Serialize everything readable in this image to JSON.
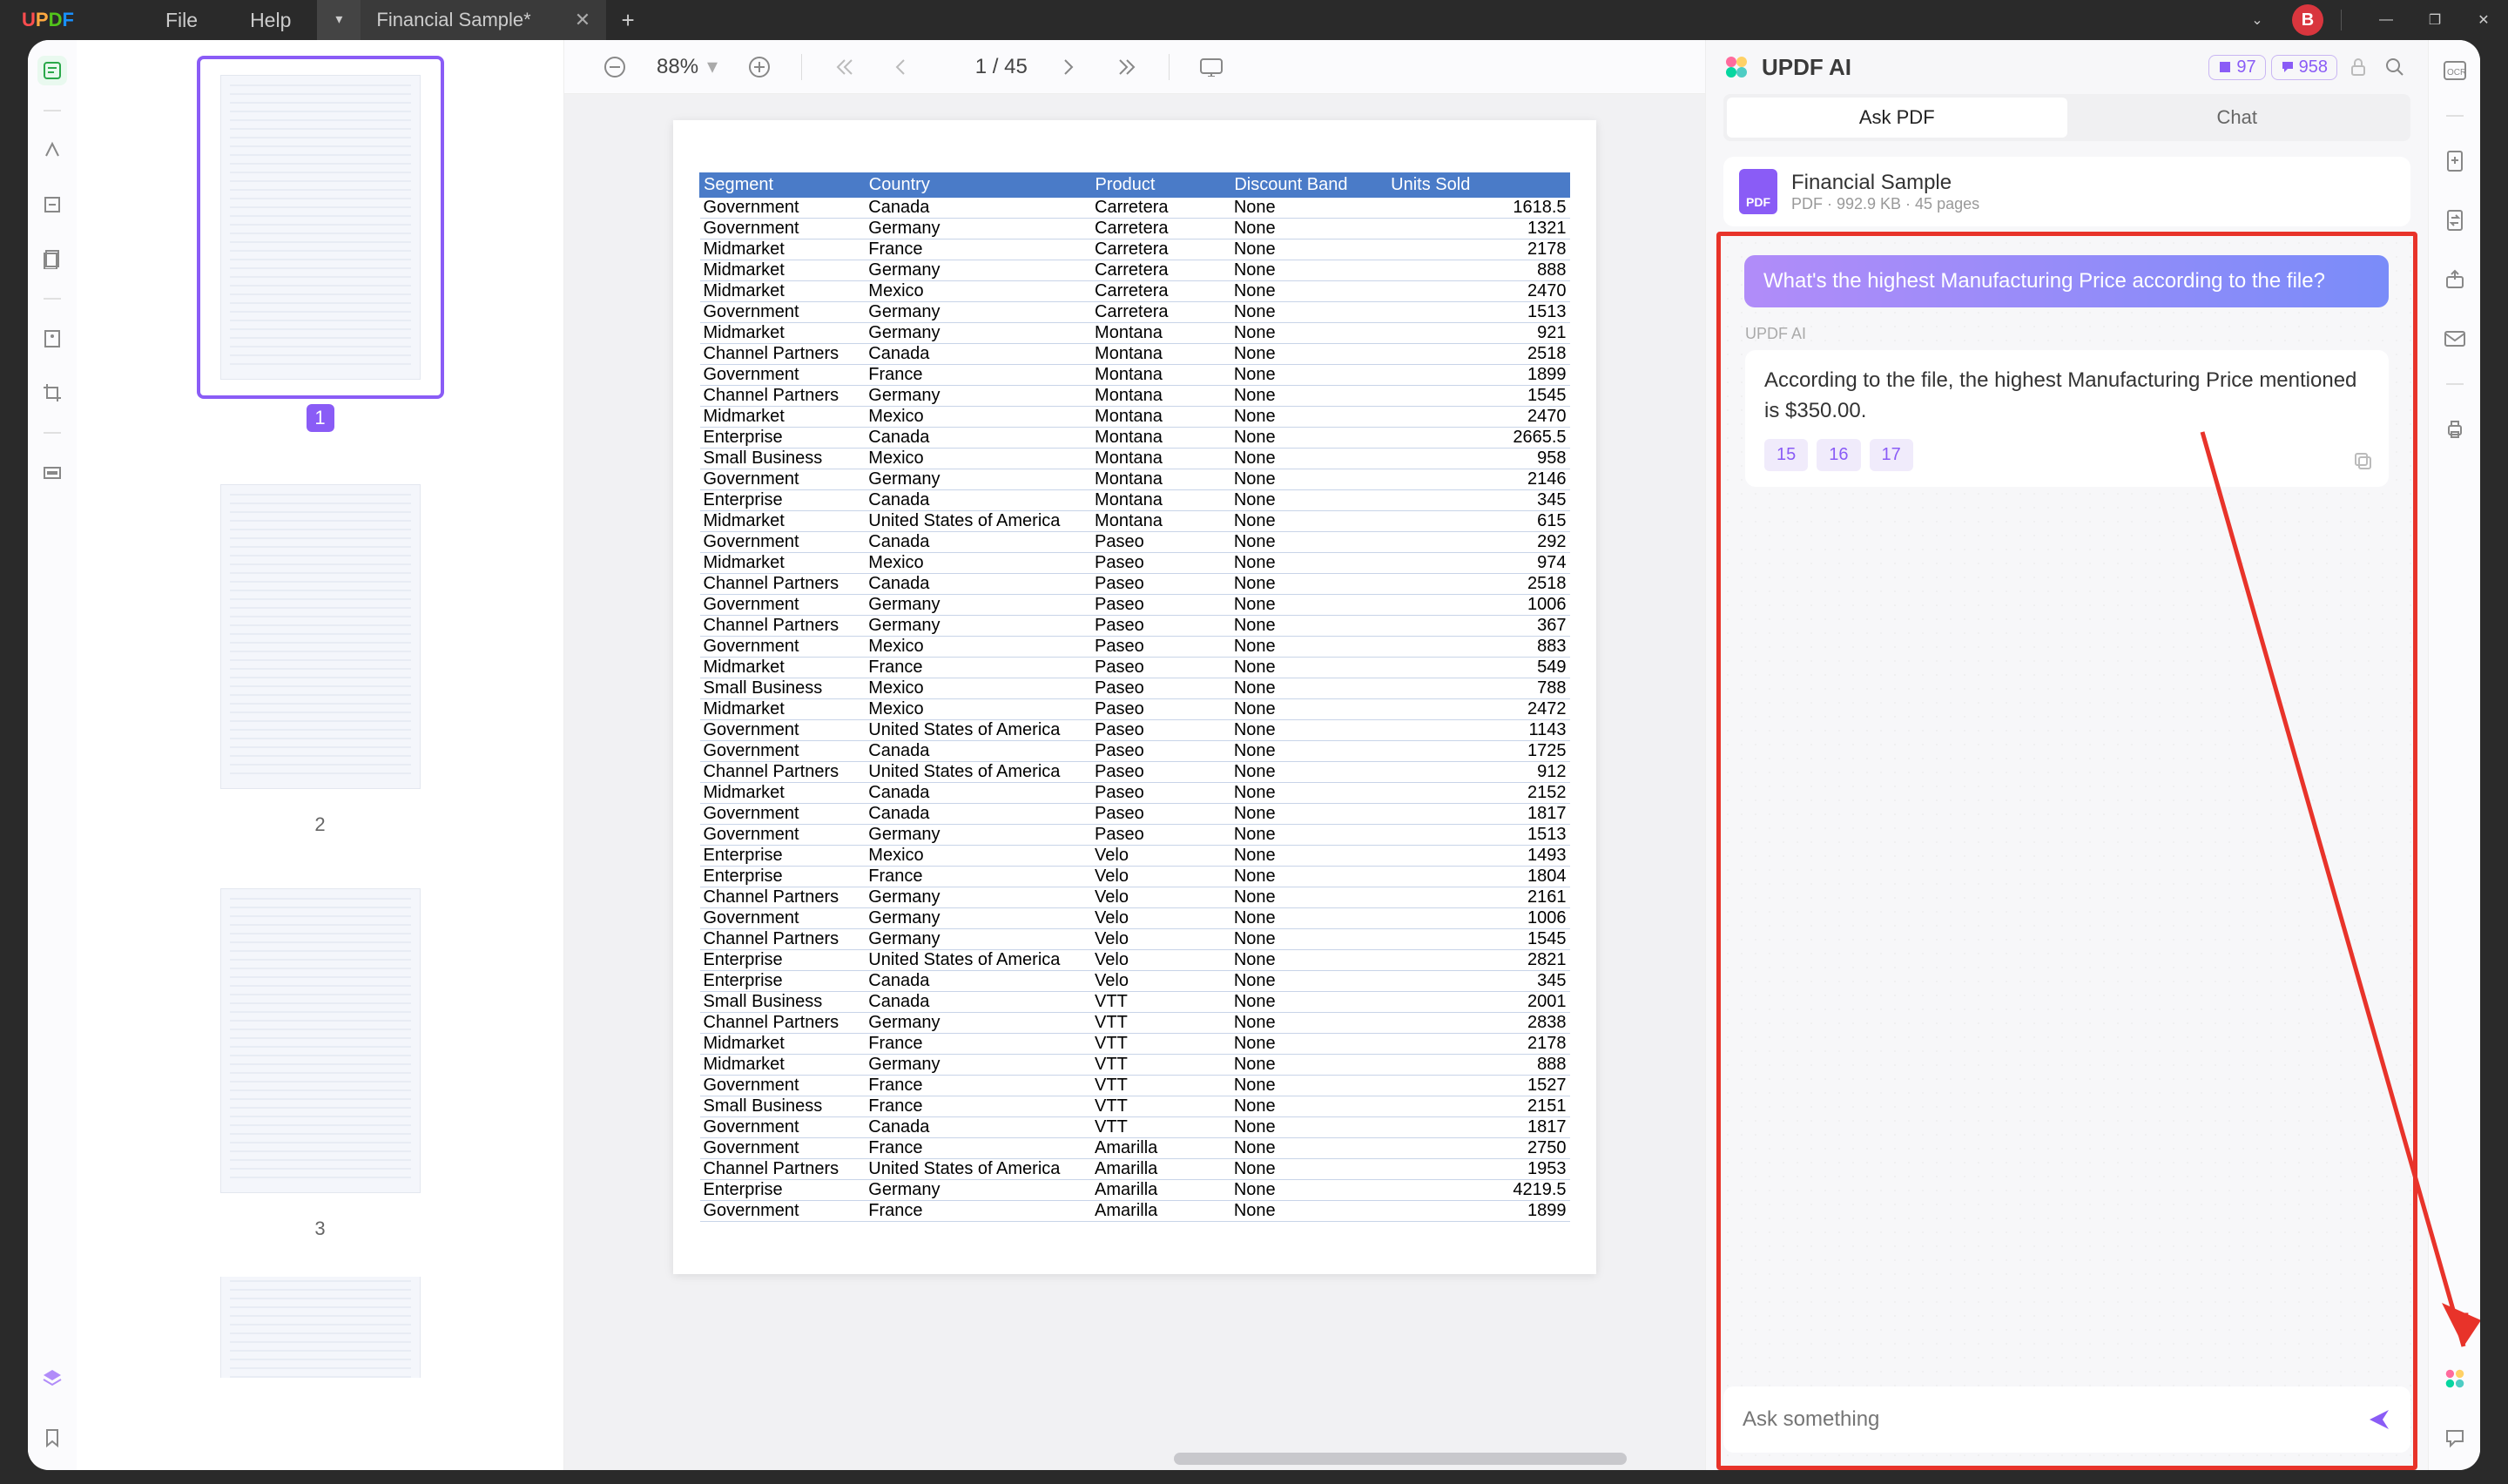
{
  "logo": "UPDF",
  "menu": {
    "file": "File",
    "help": "Help"
  },
  "tab": {
    "title": "Financial Sample*"
  },
  "avatar": "B",
  "toolbar": {
    "zoom": "88%",
    "page_cur": "1",
    "page_sep": "/",
    "page_total": "45"
  },
  "thumbs": [
    "1",
    "2",
    "3"
  ],
  "table": {
    "headers": [
      "Segment",
      "Country",
      "Product",
      "Discount Band",
      "Units Sold"
    ],
    "rows": [
      [
        "Government",
        "Canada",
        "Carretera",
        "None",
        "1618.5"
      ],
      [
        "Government",
        "Germany",
        "Carretera",
        "None",
        "1321"
      ],
      [
        "Midmarket",
        "France",
        "Carretera",
        "None",
        "2178"
      ],
      [
        "Midmarket",
        "Germany",
        "Carretera",
        "None",
        "888"
      ],
      [
        "Midmarket",
        "Mexico",
        "Carretera",
        "None",
        "2470"
      ],
      [
        "Government",
        "Germany",
        "Carretera",
        "None",
        "1513"
      ],
      [
        "Midmarket",
        "Germany",
        "Montana",
        "None",
        "921"
      ],
      [
        "Channel Partners",
        "Canada",
        "Montana",
        "None",
        "2518"
      ],
      [
        "Government",
        "France",
        "Montana",
        "None",
        "1899"
      ],
      [
        "Channel Partners",
        "Germany",
        "Montana",
        "None",
        "1545"
      ],
      [
        "Midmarket",
        "Mexico",
        "Montana",
        "None",
        "2470"
      ],
      [
        "Enterprise",
        "Canada",
        "Montana",
        "None",
        "2665.5"
      ],
      [
        "Small Business",
        "Mexico",
        "Montana",
        "None",
        "958"
      ],
      [
        "Government",
        "Germany",
        "Montana",
        "None",
        "2146"
      ],
      [
        "Enterprise",
        "Canada",
        "Montana",
        "None",
        "345"
      ],
      [
        "Midmarket",
        "United States of America",
        "Montana",
        "None",
        "615"
      ],
      [
        "Government",
        "Canada",
        "Paseo",
        "None",
        "292"
      ],
      [
        "Midmarket",
        "Mexico",
        "Paseo",
        "None",
        "974"
      ],
      [
        "Channel Partners",
        "Canada",
        "Paseo",
        "None",
        "2518"
      ],
      [
        "Government",
        "Germany",
        "Paseo",
        "None",
        "1006"
      ],
      [
        "Channel Partners",
        "Germany",
        "Paseo",
        "None",
        "367"
      ],
      [
        "Government",
        "Mexico",
        "Paseo",
        "None",
        "883"
      ],
      [
        "Midmarket",
        "France",
        "Paseo",
        "None",
        "549"
      ],
      [
        "Small Business",
        "Mexico",
        "Paseo",
        "None",
        "788"
      ],
      [
        "Midmarket",
        "Mexico",
        "Paseo",
        "None",
        "2472"
      ],
      [
        "Government",
        "United States of America",
        "Paseo",
        "None",
        "1143"
      ],
      [
        "Government",
        "Canada",
        "Paseo",
        "None",
        "1725"
      ],
      [
        "Channel Partners",
        "United States of America",
        "Paseo",
        "None",
        "912"
      ],
      [
        "Midmarket",
        "Canada",
        "Paseo",
        "None",
        "2152"
      ],
      [
        "Government",
        "Canada",
        "Paseo",
        "None",
        "1817"
      ],
      [
        "Government",
        "Germany",
        "Paseo",
        "None",
        "1513"
      ],
      [
        "Enterprise",
        "Mexico",
        "Velo",
        "None",
        "1493"
      ],
      [
        "Enterprise",
        "France",
        "Velo",
        "None",
        "1804"
      ],
      [
        "Channel Partners",
        "Germany",
        "Velo",
        "None",
        "2161"
      ],
      [
        "Government",
        "Germany",
        "Velo",
        "None",
        "1006"
      ],
      [
        "Channel Partners",
        "Germany",
        "Velo",
        "None",
        "1545"
      ],
      [
        "Enterprise",
        "United States of America",
        "Velo",
        "None",
        "2821"
      ],
      [
        "Enterprise",
        "Canada",
        "Velo",
        "None",
        "345"
      ],
      [
        "Small Business",
        "Canada",
        "VTT",
        "None",
        "2001"
      ],
      [
        "Channel Partners",
        "Germany",
        "VTT",
        "None",
        "2838"
      ],
      [
        "Midmarket",
        "France",
        "VTT",
        "None",
        "2178"
      ],
      [
        "Midmarket",
        "Germany",
        "VTT",
        "None",
        "888"
      ],
      [
        "Government",
        "France",
        "VTT",
        "None",
        "1527"
      ],
      [
        "Small Business",
        "France",
        "VTT",
        "None",
        "2151"
      ],
      [
        "Government",
        "Canada",
        "VTT",
        "None",
        "1817"
      ],
      [
        "Government",
        "France",
        "Amarilla",
        "None",
        "2750"
      ],
      [
        "Channel Partners",
        "United States of America",
        "Amarilla",
        "None",
        "1953"
      ],
      [
        "Enterprise",
        "Germany",
        "Amarilla",
        "None",
        "4219.5"
      ],
      [
        "Government",
        "France",
        "Amarilla",
        "None",
        "1899"
      ]
    ]
  },
  "ai": {
    "title": "UPDF AI",
    "stat1": "97",
    "stat2": "958",
    "tabs": {
      "ask": "Ask PDF",
      "chat": "Chat"
    },
    "file": {
      "name": "Financial Sample",
      "meta": "PDF · 992.9 KB · 45 pages",
      "badge": "PDF"
    },
    "question": "What's the highest Manufacturing Price according to the file?",
    "label": "UPDF AI",
    "answer": "According to the file, the highest Manufacturing Price mentioned is $350.00.",
    "refs": [
      "15",
      "16",
      "17"
    ],
    "placeholder": "Ask something"
  }
}
